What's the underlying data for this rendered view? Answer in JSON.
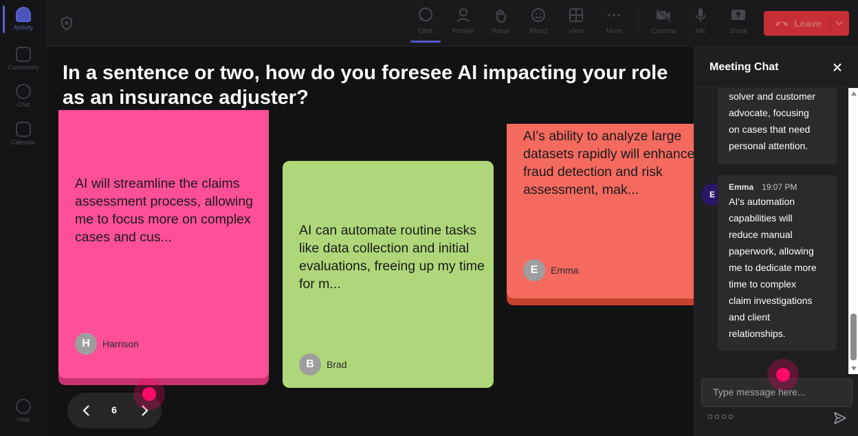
{
  "rail": {
    "items": [
      {
        "label": "Activity",
        "active": true
      },
      {
        "label": "Community",
        "active": false
      },
      {
        "label": "Chat",
        "active": false
      },
      {
        "label": "Calendar",
        "active": false
      }
    ],
    "help_label": "Help"
  },
  "toolbar": {
    "buttons": [
      {
        "label": "Chat",
        "icon": "chat-icon",
        "active": true
      },
      {
        "label": "People",
        "icon": "people-icon"
      },
      {
        "label": "Raise",
        "icon": "raise-hand-icon"
      },
      {
        "label": "React",
        "icon": "smiley-icon"
      },
      {
        "label": "View",
        "icon": "grid-view-icon"
      },
      {
        "label": "More",
        "icon": "more-dots-icon"
      },
      {
        "label": "Camera",
        "icon": "camera-off-icon"
      },
      {
        "label": "Mic",
        "icon": "mic-icon"
      },
      {
        "label": "Share",
        "icon": "share-icon"
      }
    ],
    "leave_label": "Leave",
    "leave_color": "#c62f35"
  },
  "main": {
    "question": "In a sentence or two, how do you foresee AI impacting your role as an insurance adjuster?",
    "cards": [
      {
        "text": "AI will streamline the claims assessment process, allowing me to focus more on complex cases and cus...",
        "author": "Harrison",
        "initial": "H",
        "color": "#ff4f98"
      },
      {
        "text": "AI can automate routine tasks like data collection and initial evaluations, freeing up my time for m...",
        "author": "Brad",
        "initial": "B",
        "color": "#afd77a"
      },
      {
        "text": "AI's ability to analyze large datasets rapidly will enhance fraud detection and risk assessment, mak...",
        "author": "Emma",
        "initial": "E",
        "color": "#f46a5f"
      }
    ],
    "pager": {
      "page": "6"
    }
  },
  "chat": {
    "title": "Meeting Chat",
    "messages": [
      {
        "text_lines": [
          "solver and customer",
          "advocate, focusing",
          "on cases that need",
          "personal attention."
        ]
      },
      {
        "author": "Emma",
        "initial": "E",
        "time": "19:07 PM",
        "text_lines": [
          "AI's automation",
          "capabilities will",
          "reduce manual",
          "paperwork, allowing",
          "me to dedicate more",
          "time to complex",
          "claim investigations",
          "and client",
          "relationships."
        ]
      }
    ],
    "compose_placeholder": "Type message here..."
  }
}
